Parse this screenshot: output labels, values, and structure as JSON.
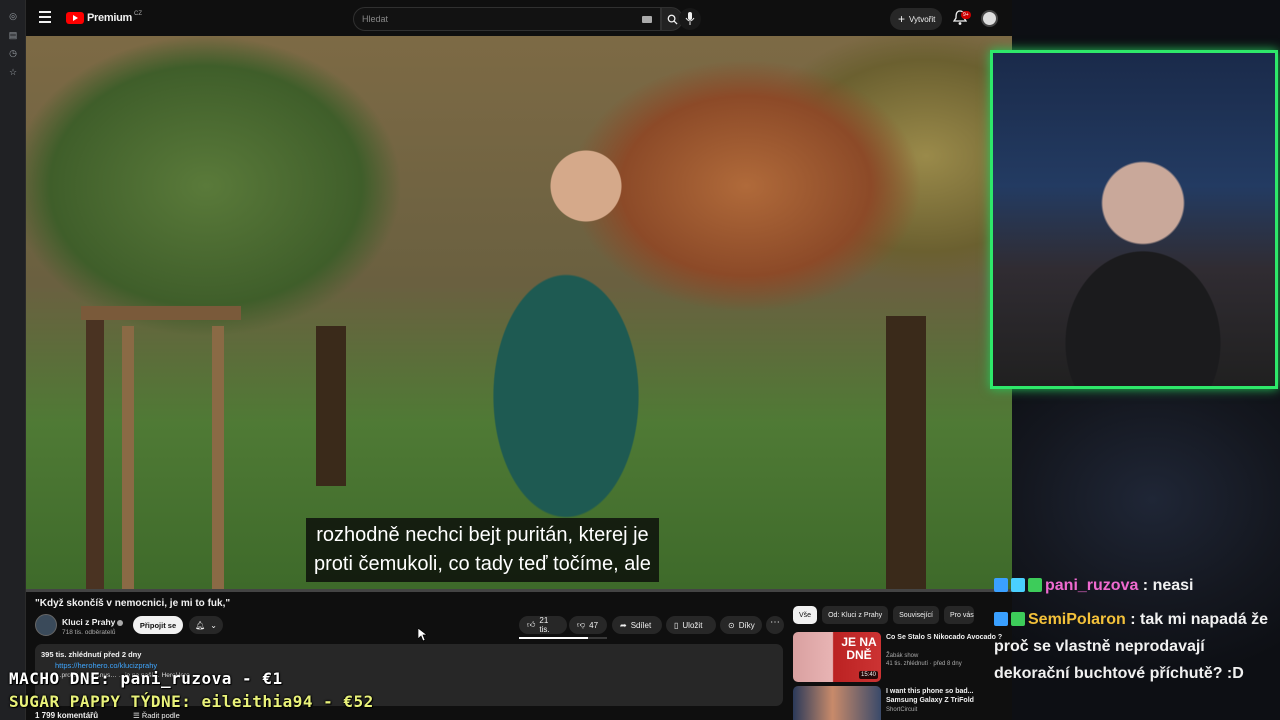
{
  "youtube": {
    "brand": "Premium",
    "country_code": "CZ",
    "search_placeholder": "Hledat",
    "create_label": "Vytvořit",
    "notification_count": "9+"
  },
  "video": {
    "subtitle_line1": "rozhodně nechci bejt puritán, kterej je",
    "subtitle_line2": "proti čemukoli, co tady teď točíme, ale",
    "title": "\"Když skončíš v nemocnici, je mi to fuk,\"",
    "channel": "Kluci z Prahy",
    "subscribers": "718 tis. odběratelů",
    "join_label": "Připojit se",
    "likes": "21 tis.",
    "dislikes": "47",
    "share_label": "Sdílet",
    "save_label": "Uložit",
    "thanks_label": "Díky",
    "more_label": "⋯"
  },
  "description": {
    "stats": "395 tis. zhlédnutí  před 2 dny",
    "link": "https://herohero.co/klucizprahy",
    "text": "…pro pi… …bonus… …je na naší… HeroHero"
  },
  "comments": {
    "count": "1 799 komentářů",
    "sort_label": "Řadit podle"
  },
  "chips": [
    "Vše",
    "Od: Kluci z Prahy",
    "Související",
    "Pro vás"
  ],
  "recommendations": [
    {
      "title": "Co Se Stalo S Nikocado Avocado ?",
      "channel": "Žabák show",
      "meta": "41 tis. zhlédnutí · před 8 dny",
      "duration": "15:40",
      "thumb_text": "JE NA DNĚ"
    },
    {
      "title": "I want this phone so bad... Samsung Galaxy Z TriFold",
      "channel": "ShortCircuit",
      "meta": "",
      "duration": "",
      "thumb_text": ""
    }
  ],
  "chat": [
    {
      "user": "pani_ruzova",
      "sep": " : ",
      "message": "neasi",
      "user_color": "#ef6ad0"
    },
    {
      "user": "SemiPolaron",
      "sep": " : ",
      "message": "tak mi napadá že proč se vlastně neprodavají dekorační buchtové příchutě? :D",
      "user_color": "#f3c13a"
    }
  ],
  "overlay": {
    "line1": "MACHO DNE: pani_ruzova - €1",
    "line2": "SUGAR PAPPY TÝDNE: eileithia94 - €52"
  },
  "colors": {
    "accent_green": "#2ee86a",
    "yt_red": "#ff0000",
    "overlay_yellow": "#e9f27a"
  }
}
